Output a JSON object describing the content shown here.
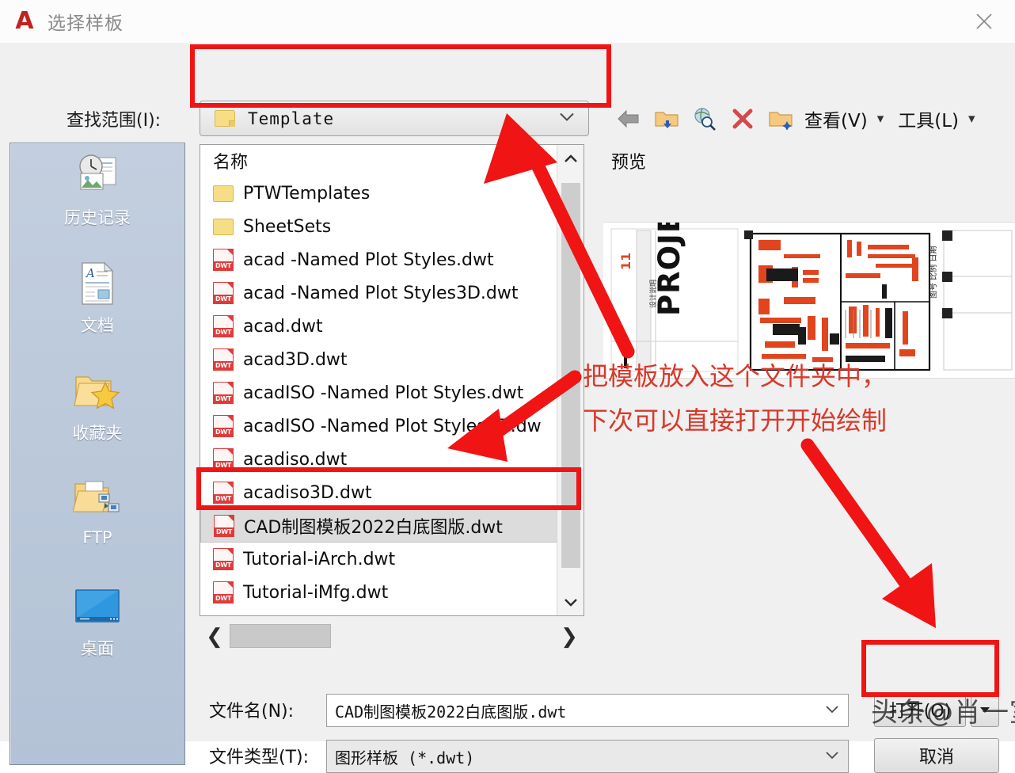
{
  "window": {
    "title": "选择样板",
    "logo": "autocad-a-logo",
    "close_label": "✕"
  },
  "lookin": {
    "label": "查找范围(I):",
    "value": "Template",
    "icon": "folder-icon",
    "chevron": "chevron-down-icon"
  },
  "toolbar": {
    "buttons": [
      {
        "name": "back-icon",
        "title": "后退"
      },
      {
        "name": "up-folder-icon",
        "title": "向上一级"
      },
      {
        "name": "search-web-icon",
        "title": "搜索 Web"
      },
      {
        "name": "delete-icon",
        "title": "删除"
      },
      {
        "name": "new-folder-icon",
        "title": "创建新文件夹"
      }
    ],
    "menus": [
      {
        "label": "查看(V)",
        "name": "view-menu"
      },
      {
        "label": "工具(L)",
        "name": "tools-menu"
      }
    ],
    "menu_arrow": "▾"
  },
  "places": [
    {
      "label": "历史记录",
      "icon": "history-icon"
    },
    {
      "label": "文档",
      "icon": "documents-icon"
    },
    {
      "label": "收藏夹",
      "icon": "favorites-icon"
    },
    {
      "label": "FTP",
      "icon": "ftp-icon"
    },
    {
      "label": "桌面",
      "icon": "desktop-icon"
    }
  ],
  "filelist": {
    "column_header": "名称",
    "items": [
      {
        "name": "PTWTemplates",
        "type": "folder",
        "selected": false
      },
      {
        "name": "SheetSets",
        "type": "folder",
        "selected": false
      },
      {
        "name": "acad -Named Plot Styles.dwt",
        "type": "dwt",
        "selected": false
      },
      {
        "name": "acad -Named Plot Styles3D.dwt",
        "type": "dwt",
        "selected": false
      },
      {
        "name": "acad.dwt",
        "type": "dwt",
        "selected": false
      },
      {
        "name": "acad3D.dwt",
        "type": "dwt",
        "selected": false
      },
      {
        "name": "acadISO -Named Plot Styles.dwt",
        "type": "dwt",
        "selected": false
      },
      {
        "name": "acadISO -Named Plot Styles3D.dw",
        "type": "dwt",
        "selected": false
      },
      {
        "name": "acadiso.dwt",
        "type": "dwt",
        "selected": false
      },
      {
        "name": "acadiso3D.dwt",
        "type": "dwt",
        "selected": false
      },
      {
        "name": "CAD制图模板2022白底图版.dwt",
        "type": "dwt",
        "selected": true
      },
      {
        "name": "Tutorial-iArch.dwt",
        "type": "dwt",
        "selected": false
      },
      {
        "name": "Tutorial-iMfg.dwt",
        "type": "dwt",
        "selected": false
      }
    ],
    "scroll_up": "⌃",
    "scroll_down": "⌄",
    "scroll_left": "❮",
    "scroll_right": "❯"
  },
  "preview": {
    "label": "预览",
    "thumbnail_text": "PROJECT"
  },
  "fields": {
    "filename_label": "文件名(N):",
    "filename_value": "CAD制图模板2022白底图版.dwt",
    "filetype_label": "文件类型(T):",
    "filetype_value": "图形样板 (*.dwt)"
  },
  "actions": {
    "open_label": "打开(O)",
    "open_split_arrow": "▾",
    "cancel_label": "取消"
  },
  "annotations": {
    "line1": "把模板放入这个文件夹中，",
    "line2": "下次可以直接打开开始绘制",
    "highlight_color": "#f01414",
    "text_color": "#d9382a"
  },
  "watermark": {
    "text": "头条@肖一室"
  }
}
